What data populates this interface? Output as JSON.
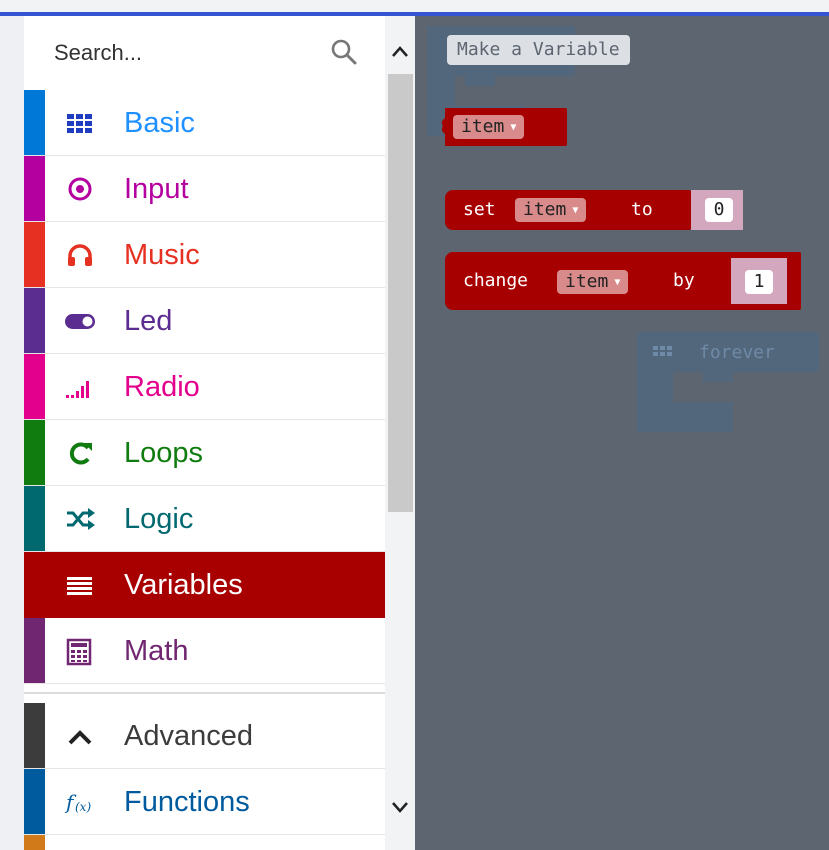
{
  "search": {
    "placeholder": "Search...",
    "icon": "search-icon"
  },
  "categories": [
    {
      "label": "Basic",
      "color": "#1E90FF",
      "bar": "#0078D7",
      "icon": "grid-icon"
    },
    {
      "label": "Input",
      "color": "#B4009E",
      "bar": "#B4009E",
      "icon": "target-icon"
    },
    {
      "label": "Music",
      "color": "#E63022",
      "bar": "#E63022",
      "icon": "headphones-icon"
    },
    {
      "label": "Led",
      "color": "#5C2D91",
      "bar": "#5C2D91",
      "icon": "toggle-icon"
    },
    {
      "label": "Radio",
      "color": "#E3008C",
      "bar": "#E3008C",
      "icon": "signal-bars-icon"
    },
    {
      "label": "Loops",
      "color": "#107C10",
      "bar": "#107C10",
      "icon": "refresh-icon"
    },
    {
      "label": "Logic",
      "color": "#006970",
      "bar": "#006970",
      "icon": "shuffle-icon"
    },
    {
      "label": "Variables",
      "color": "#A80000",
      "bar": "#A80000",
      "icon": "list-icon",
      "selected": true
    },
    {
      "label": "Math",
      "color": "#712672",
      "bar": "#712672",
      "icon": "calculator-icon"
    },
    {
      "label": "Advanced",
      "color": "#3C3C3C",
      "bar": "#3C3C3C",
      "icon": "chevron-up-icon"
    },
    {
      "label": "Functions",
      "color": "#005A9E",
      "bar": "#005A9E",
      "icon": "function-icon"
    }
  ],
  "workspace": {
    "make_variable_label": "Make a Variable",
    "variable_block": {
      "name": "item"
    },
    "set_block": {
      "keyword": "set",
      "variable": "item",
      "to": "to",
      "value": "0"
    },
    "change_block": {
      "keyword": "change",
      "variable": "item",
      "by": "by",
      "value": "1"
    },
    "ghost_block_label": "forever"
  }
}
